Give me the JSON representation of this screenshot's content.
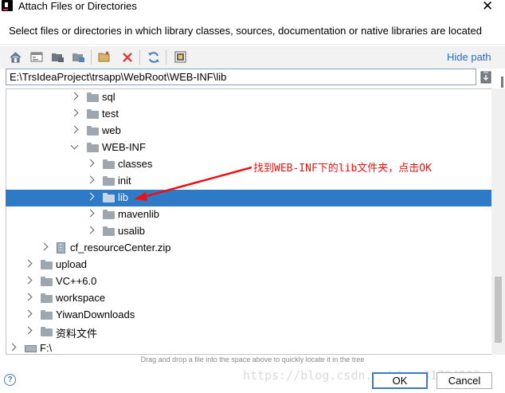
{
  "window": {
    "title": "Attach Files or Directories",
    "close_glyph": "✕"
  },
  "description": "Select files or directories in which library classes, sources, documentation or native libraries are located",
  "toolbar": {
    "icons": [
      "home-icon",
      "desktop-icon",
      "project-icon",
      "module-icon",
      "new-folder-icon",
      "delete-icon",
      "refresh-icon",
      "show-hidden-icon"
    ],
    "hide_path_label": "Hide path"
  },
  "path": {
    "value": "E:\\TrsIdeaProject\\trsapp\\WebRoot\\WEB-INF\\lib"
  },
  "tree": [
    {
      "label": "sql",
      "arrow": "right",
      "icon": "folder"
    },
    {
      "label": "test",
      "arrow": "right",
      "icon": "folder"
    },
    {
      "label": "web",
      "arrow": "right",
      "icon": "folder"
    },
    {
      "label": "WEB-INF",
      "arrow": "down",
      "icon": "folder"
    },
    {
      "label": "classes",
      "arrow": "right",
      "icon": "folder"
    },
    {
      "label": "init",
      "arrow": "right",
      "icon": "folder"
    },
    {
      "label": "lib",
      "arrow": "right",
      "icon": "folder",
      "selected": true
    },
    {
      "label": "mavenlib",
      "arrow": "right",
      "icon": "folder"
    },
    {
      "label": "usalib",
      "arrow": "right",
      "icon": "folder"
    },
    {
      "label": "cf_resourceCenter.zip",
      "arrow": "right",
      "icon": "zip"
    },
    {
      "label": "upload",
      "arrow": "right",
      "icon": "folder"
    },
    {
      "label": "VC++6.0",
      "arrow": "right",
      "icon": "folder"
    },
    {
      "label": "workspace",
      "arrow": "right",
      "icon": "folder"
    },
    {
      "label": "YiwanDownloads",
      "arrow": "right",
      "icon": "folder"
    },
    {
      "label": "资料文件",
      "arrow": "right",
      "icon": "folder"
    },
    {
      "label": "F:\\",
      "arrow": "right",
      "icon": "drive"
    }
  ],
  "annotation": {
    "text": "找到WEB-INF下的lib文件夹，点击OK",
    "color": "#e11111"
  },
  "hint": "Drag and drop a file into the space above to quickly locate it in the tree",
  "buttons": {
    "help": "?",
    "ok": "OK",
    "cancel": "Cancel"
  },
  "watermark": "https://blog.csdn.net/qq_41794292"
}
